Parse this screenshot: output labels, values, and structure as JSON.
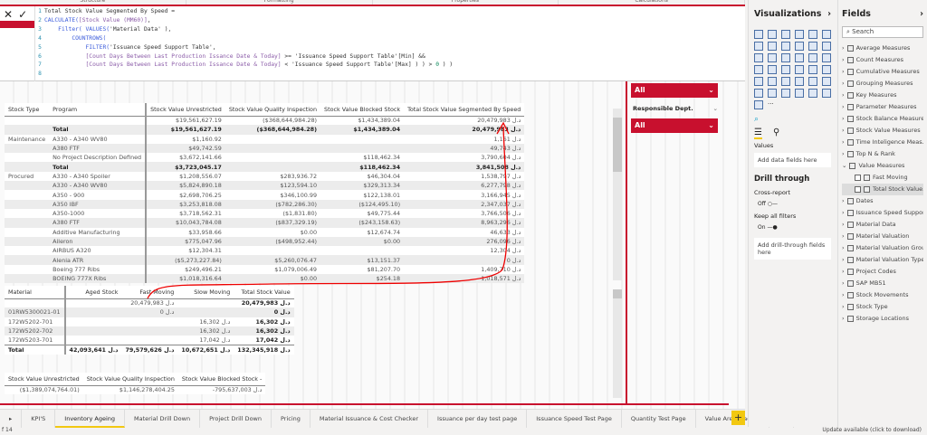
{
  "ribbon": [
    "Structure",
    "Formatting",
    "Properties",
    "Calculations"
  ],
  "formula": {
    "lines": [
      [
        {
          "t": "Total Stock Value Segmented By Speed =",
          "c": "st"
        }
      ],
      [
        {
          "t": "CALCULATE(",
          "c": "kw"
        },
        {
          "t": "[Stock Value (MM60)]",
          "c": "ms"
        },
        {
          "t": ",",
          "c": "st"
        }
      ],
      [
        {
          "t": "    Filter( ",
          "c": "kw"
        },
        {
          "t": "VALUES(",
          "c": "kw"
        },
        {
          "t": "'Material Data' ),",
          "c": "st"
        }
      ],
      [
        {
          "t": "        COUNTROWS(",
          "c": "kw"
        }
      ],
      [
        {
          "t": "            FILTER(",
          "c": "kw"
        },
        {
          "t": "'Issuance Speed Support Table',",
          "c": "st"
        }
      ],
      [
        {
          "t": "            [Count Days Between Last Production Issance Date & Today]",
          "c": "ms"
        },
        {
          "t": " >= 'Issuance Speed Support Table'[Min] &&",
          "c": "st"
        }
      ],
      [
        {
          "t": "            [Count Days Between Last Production Issance Date & Today]",
          "c": "ms"
        },
        {
          "t": " < 'Issuance Speed Support Table'[Max] ) ) > ",
          "c": "st"
        },
        {
          "t": "0",
          "c": "nm"
        },
        {
          "t": " ) )",
          "c": "st"
        }
      ],
      []
    ]
  },
  "main_table": {
    "headers": [
      "Stock Type",
      "Program",
      "Stock Value Unrestricted",
      "Stock Value Quality Inspection",
      "Stock Value Blocked Stock",
      "Total Stock Value Segmented By Speed"
    ],
    "rows": [
      [
        "",
        "",
        "$19,561,627.19",
        "($368,644,984.28)",
        "$1,434,389.04",
        "20,479,983 د.ل"
      ],
      [
        "",
        "Total",
        "$19,561,627.19",
        "($368,644,984.28)",
        "$1,434,389.04",
        "20,479,983 د.ل"
      ],
      [
        "Maintenance",
        "A330 - A340 WV80",
        "$1,160.92",
        "",
        "",
        "1,161 د.ل"
      ],
      [
        "",
        "A380 FTF",
        "$49,742.59",
        "",
        "",
        "49,743 د.ل"
      ],
      [
        "",
        "No Project Description Defined",
        "$3,672,141.66",
        "",
        "$118,462.34",
        "3,790,604 د.ل"
      ],
      [
        "",
        "Total",
        "$3,723,045.17",
        "",
        "$118,462.34",
        "3,841,508 د.ل"
      ],
      [
        "Procured",
        "A330 - A340 Spoiler",
        "$1,208,556.07",
        "$283,936.72",
        "$46,304.04",
        "1,538,797 د.ل"
      ],
      [
        "",
        "A330 - A340 WV80",
        "$5,824,890.18",
        "$123,594.10",
        "$329,313.34",
        "6,277,798 د.ل"
      ],
      [
        "",
        "A350 - 900",
        "$2,698,706.25",
        "$346,100.99",
        "$122,138.01",
        "3,166,945 د.ل"
      ],
      [
        "",
        "A350 IBF",
        "$3,253,818.08",
        "($782,286.30)",
        "($124,495.10)",
        "2,347,037 د.ل"
      ],
      [
        "",
        "A350-1000",
        "$3,718,562.31",
        "($1,831.80)",
        "$49,775.44",
        "3,766,506 د.ل"
      ],
      [
        "",
        "A380 FTF",
        "$10,043,784.08",
        "($837,329.19)",
        "($243,158.63)",
        "8,963,296 د.ل"
      ],
      [
        "",
        "Additive Manufacturing",
        "$33,958.66",
        "$0.00",
        "$12,674.74",
        "46,633 د.ل"
      ],
      [
        "",
        "Aileron",
        "$775,047.96",
        "($498,952.44)",
        "$0.00",
        "276,096 د.ل"
      ],
      [
        "",
        "AIRBUS A320",
        "$12,304.31",
        "",
        "",
        "12,304 د.ل"
      ],
      [
        "",
        "Alenia ATR",
        "($5,273,227.84)",
        "$5,260,076.47",
        "$13,151.37",
        "0 د.ل"
      ],
      [
        "",
        "Boeing 777 Ribs",
        "$249,496.21",
        "$1,079,006.49",
        "$81,207.70",
        "1,409,710 د.ل"
      ],
      [
        "",
        "BOEING 777X Ribs",
        "$1,018,316.64",
        "$0.00",
        "$254.18",
        "1,018,571 د.ل"
      ]
    ]
  },
  "bottom_table": {
    "headers": [
      "Material",
      "Aged Stock",
      "Fast Moving",
      "Slow Moving",
      "Total Stock Value"
    ],
    "rows": [
      [
        "",
        "",
        "20,479,983 د.ل",
        "",
        "20,479,983 د.ل"
      ],
      [
        "01RW5300021-01",
        "",
        "0 د.ل",
        "",
        "0 د.ل"
      ],
      [
        "172W5202-701",
        "",
        "",
        "16,302 د.ل",
        "16,302 د.ل"
      ],
      [
        "172W5202-702",
        "",
        "",
        "16,302 د.ل",
        "16,302 د.ل"
      ],
      [
        "172W5203-701",
        "",
        "",
        "17,042 د.ل",
        "17,042 د.ل"
      ]
    ],
    "total": [
      "Total",
      "42,093,641 د.ل",
      "79,579,626 د.ل",
      "10,672,651 د.ل",
      "132,345,918 د.ل"
    ]
  },
  "cards": {
    "headers": [
      "Stock Value Unrestricted",
      "Stock Value Quality Inspection",
      "Stock Value Blocked Stock -"
    ],
    "values": [
      "($1,389,074,764.01)",
      "$1,146,278,404.25",
      "-795,637,003 د.ل"
    ]
  },
  "slicers": {
    "first_value": "All",
    "label": "Responsible Dept.",
    "second_value": "All"
  },
  "tabs": [
    "KPI'S",
    "Inventory Ageing",
    "Material Drill Down",
    "Project Drill Down",
    "Pricing",
    "Material Issuance & Cost Checker",
    "Issuance per day test page",
    "Issuance Speed Test Page",
    "Quantity Test Page",
    "Value Area Tracker",
    "In"
  ],
  "active_tab": "Inventory Ageing",
  "status": {
    "page": "f 14",
    "update": "Update available (click to download)"
  },
  "viz": {
    "title": "Visualizations",
    "values_label": "Values",
    "add_fields": "Add data fields here",
    "drill_title": "Drill through",
    "cross_report": "Cross-report",
    "off": "Off",
    "keep_filters": "Keep all filters",
    "on": "On",
    "add_drill": "Add drill-through fields here",
    "more": "···"
  },
  "fields": {
    "title": "Fields",
    "search_placeholder": "Search",
    "items": [
      {
        "label": "Average Measures",
        "exp": "›"
      },
      {
        "label": "Count Measures",
        "exp": "›"
      },
      {
        "label": "Cumulative Measures",
        "exp": "›"
      },
      {
        "label": "Grouping Measures",
        "exp": "›"
      },
      {
        "label": "Key Measures",
        "exp": "›"
      },
      {
        "label": "Parameter Measures",
        "exp": "›"
      },
      {
        "label": "Stock Balance Measures",
        "exp": "›"
      },
      {
        "label": "Stock Value Measures",
        "exp": "›"
      },
      {
        "label": "Time Inteligence Meas...",
        "exp": "›"
      },
      {
        "label": "Top N & Rank",
        "exp": "›"
      },
      {
        "label": "Value Measures",
        "exp": "⌄"
      },
      {
        "label": "Fast Moving",
        "child": true
      },
      {
        "label": "Total Stock Value...",
        "child": true,
        "sel": true
      },
      {
        "label": "Dates",
        "exp": "›"
      },
      {
        "label": "Issuance Speed Suppor...",
        "exp": "›"
      },
      {
        "label": "Material Data",
        "exp": "›"
      },
      {
        "label": "Material Valuation",
        "exp": "›"
      },
      {
        "label": "Material Valuation Group",
        "exp": "›"
      },
      {
        "label": "Material Valuation Type",
        "exp": "›"
      },
      {
        "label": "Project Codes",
        "exp": "›"
      },
      {
        "label": "SAP MB51",
        "exp": "›"
      },
      {
        "label": "Stock Movements",
        "exp": "›"
      },
      {
        "label": "Stock Type",
        "exp": "›"
      },
      {
        "label": "Storage Locations",
        "exp": "›"
      }
    ]
  },
  "colors": {
    "accent_red": "#c8102e",
    "tab_yellow": "#f2c811"
  }
}
